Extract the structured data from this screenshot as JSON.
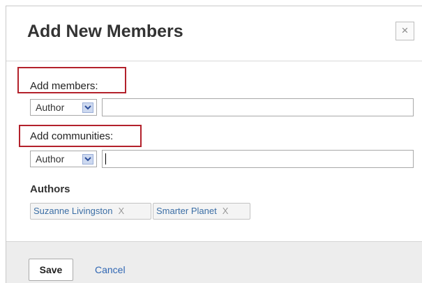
{
  "dialog": {
    "title": "Add New Members",
    "close_label": "×"
  },
  "members": {
    "label": "Add members:",
    "role_value": "Author",
    "input_value": ""
  },
  "communities": {
    "label": "Add communities:",
    "role_value": "Author",
    "input_value": ""
  },
  "authors": {
    "label": "Authors",
    "tags": [
      {
        "label": "Suzanne Livingston",
        "remove": "X"
      },
      {
        "label": "Smarter Planet",
        "remove": "X"
      }
    ]
  },
  "footer": {
    "save_label": "Save",
    "cancel_label": "Cancel"
  },
  "colors": {
    "highlight": "#b3212b",
    "link": "#2f66b3"
  },
  "icons": {
    "close": "close-icon",
    "dropdown": "chevron-down-icon"
  }
}
